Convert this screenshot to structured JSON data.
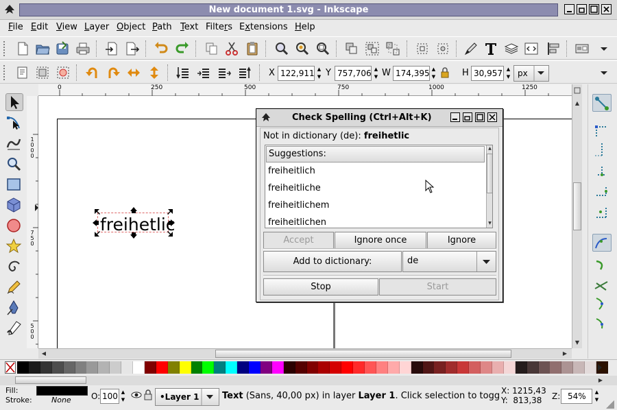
{
  "window": {
    "title": "New document 1.svg - Inkscape",
    "controls": [
      "minimize-icon",
      "maximize-icon",
      "close-icon"
    ]
  },
  "menubar": {
    "items": [
      {
        "label": "File",
        "key": "F"
      },
      {
        "label": "Edit",
        "key": "E"
      },
      {
        "label": "View",
        "key": "V"
      },
      {
        "label": "Layer",
        "key": "L"
      },
      {
        "label": "Object",
        "key": "O"
      },
      {
        "label": "Path",
        "key": "P"
      },
      {
        "label": "Text",
        "key": "T"
      },
      {
        "label": "Filters",
        "key": "r"
      },
      {
        "label": "Extensions",
        "key": "x"
      },
      {
        "label": "Help",
        "key": "H"
      }
    ]
  },
  "command_bar": {
    "icons": [
      "new-document-icon",
      "open-icon",
      "save-icon",
      "print-icon",
      "import-icon",
      "export-icon",
      "undo-icon",
      "redo-icon",
      "copy-icon",
      "cut-icon",
      "paste-icon",
      "zoom-selection-icon",
      "zoom-drawing-icon",
      "zoom-page-icon",
      "duplicate-icon",
      "group-icon",
      "ungroup-icon",
      "fill-stroke-icon",
      "align-icon",
      "text-font-icon",
      "layers-icon",
      "xml-editor-icon",
      "align-distribute-icon",
      "preferences-icon",
      "overflow-menu-icon"
    ]
  },
  "control_bar": {
    "x_label": "X",
    "x_value": "122,911",
    "y_label": "Y",
    "y_value": "757,706",
    "w_label": "W",
    "w_value": "174,395",
    "h_label": "H",
    "h_value": "30,957",
    "unit": "px",
    "lock_icon": "lock-icon"
  },
  "ruler": {
    "h_labels": [
      "0",
      "250",
      "500",
      "750",
      "1000",
      "1250"
    ],
    "v_labels": [
      "1000",
      "750",
      "500"
    ]
  },
  "canvas": {
    "text_object": "freihetlic"
  },
  "dialog": {
    "title": "Check Spelling (Ctrl+Alt+K)",
    "not_in_dict_prefix": "Not in dictionary (de): ",
    "not_in_dict_word": "freihetlic",
    "suggestions_header": "Suggestions:",
    "suggestions": [
      "freiheitlich",
      "freiheitliche",
      "freiheitlichem",
      "freiheitlichen"
    ],
    "accept_label": "Accept",
    "ignore_once_label": "Ignore once",
    "ignore_label": "Ignore",
    "add_to_dict_label": "Add to dictionary:",
    "language": "de",
    "stop_label": "Stop",
    "start_label": "Start"
  },
  "palette": {
    "colors": [
      "#000000",
      "#1a1a1a",
      "#333333",
      "#4d4d4d",
      "#666666",
      "#808080",
      "#999999",
      "#b3b3b3",
      "#cccccc",
      "#e6e6e6",
      "#ffffff",
      "#800000",
      "#ff0000",
      "#808000",
      "#ffff00",
      "#008000",
      "#00ff00",
      "#008080",
      "#00ffff",
      "#000080",
      "#0000ff",
      "#800080",
      "#ff00ff",
      "#2b0000",
      "#550000",
      "#800000",
      "#aa0000",
      "#d40000",
      "#ff0000",
      "#ff2a2a",
      "#ff5555",
      "#ff8080",
      "#ffaaaa",
      "#ffd5d5",
      "#280b0b",
      "#501616",
      "#782121",
      "#a02c2c",
      "#c83737",
      "#d35f5f",
      "#de8787",
      "#e9afaf",
      "#f4d7d7",
      "#241c1c",
      "#483737",
      "#6c5353",
      "#916f6f",
      "#ac9393",
      "#c8b7b7",
      "#e3dbdb",
      "#2b1100"
    ]
  },
  "status": {
    "fill_label": "Fill:",
    "stroke_label": "Stroke:",
    "stroke_value": "None",
    "opacity_label": "O:",
    "opacity_value": "100",
    "layer": "•Layer 1",
    "msg_bold1": "Text",
    "msg_1": " (Sans, 40,00 px) in layer ",
    "msg_bold2": "Layer 1",
    "msg_2": ". Click selection to toggl...",
    "x_coord": "X: 1215,43",
    "y_coord": "Y:  813,38",
    "zoom_label": "Z:",
    "zoom_value": "54%"
  }
}
